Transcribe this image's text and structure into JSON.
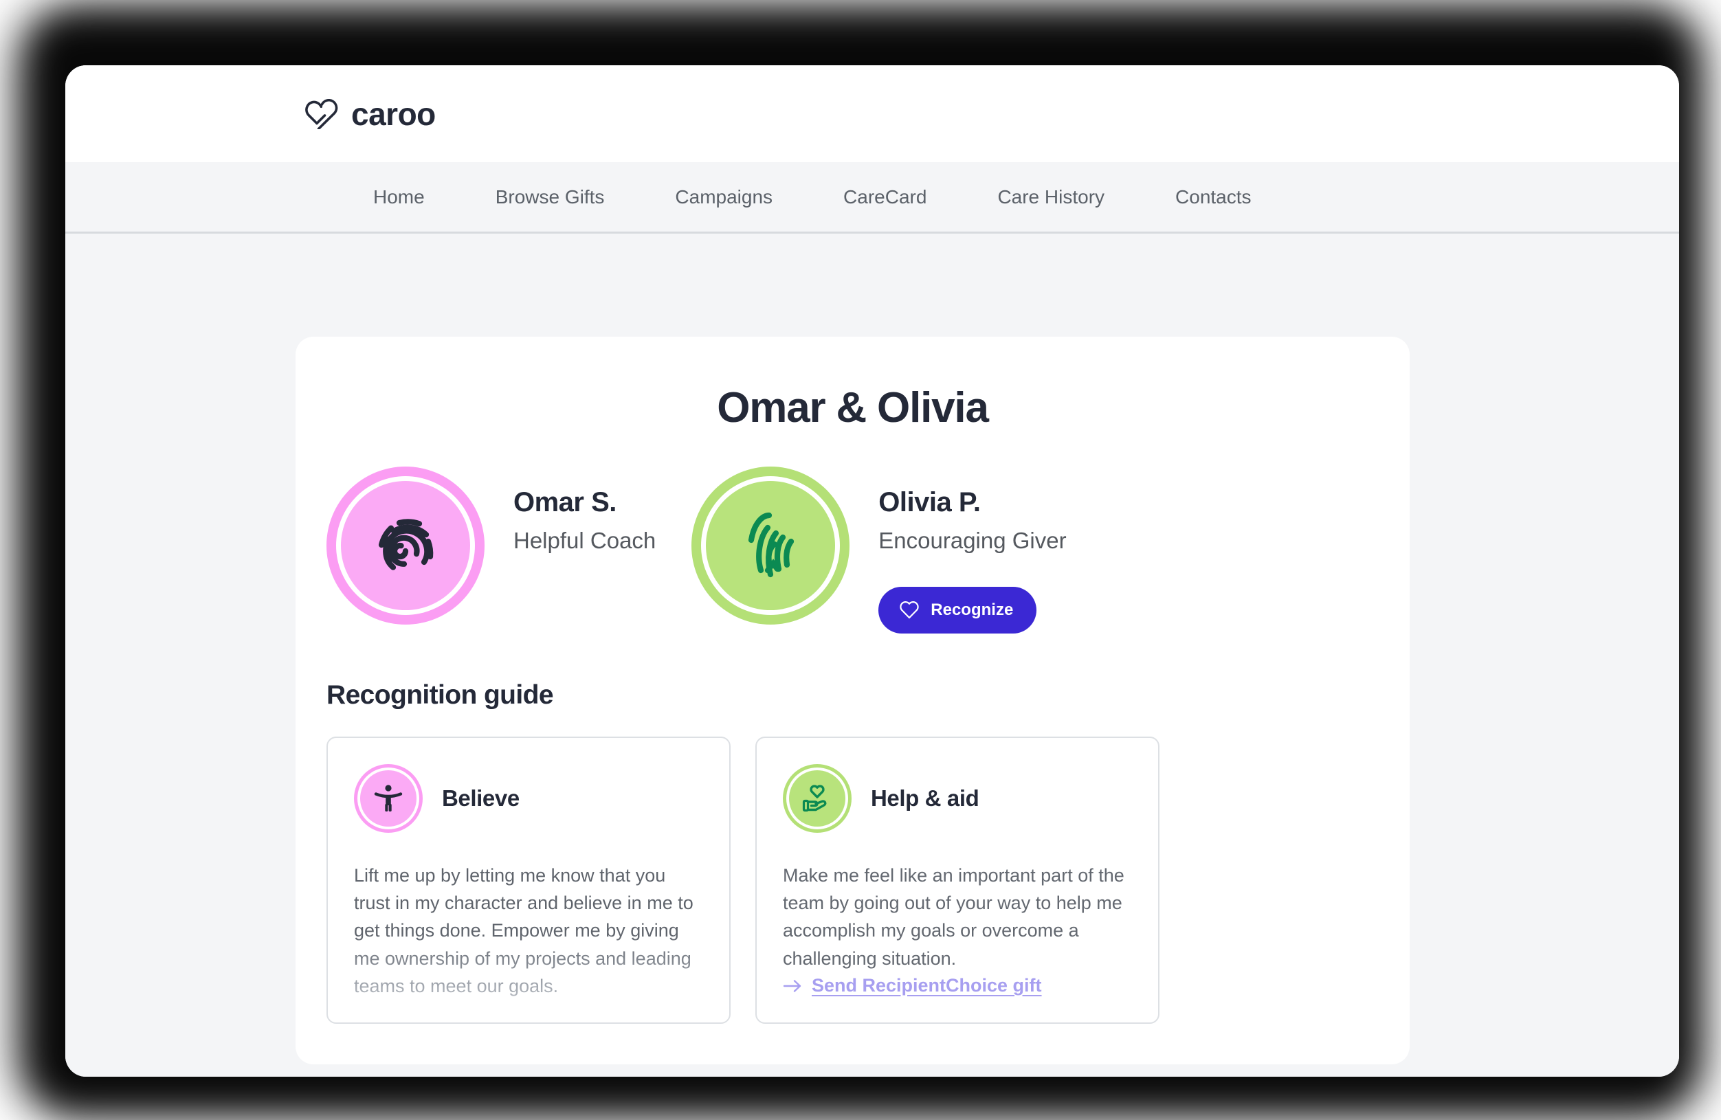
{
  "brand": {
    "name": "caroo",
    "logo_icon": "heart-check-logo-icon"
  },
  "nav": {
    "items": [
      {
        "label": "Home"
      },
      {
        "label": "Browse Gifts"
      },
      {
        "label": "Campaigns"
      },
      {
        "label": "CareCard"
      },
      {
        "label": "Care History"
      },
      {
        "label": "Contacts"
      }
    ]
  },
  "main": {
    "title": "Omar & Olivia",
    "profiles": [
      {
        "name": "Omar S.",
        "role": "Helpful Coach",
        "avatar_icon": "fingerprint-icon",
        "avatar_color": "#fbaaf5",
        "avatar_ring_color": "#fb9df3",
        "glyph_color": "#242938"
      },
      {
        "name": "Olivia P.",
        "role": "Encouraging Giver",
        "avatar_icon": "fingerprint-icon",
        "avatar_color": "#b8e37c",
        "avatar_ring_color": "#b4e076",
        "glyph_color": "#0b8a52",
        "action": {
          "label": "Recognize",
          "icon": "heart-icon",
          "color": "#3b28d4"
        }
      }
    ],
    "guide": {
      "heading": "Recognition guide",
      "cards": [
        {
          "title": "Believe",
          "icon": "person-arms-out-icon",
          "icon_color": "#fbaaf5",
          "icon_ring_color": "#fb9df3",
          "glyph_color": "#242938",
          "body": "Lift me up by letting me know that you trust in my character and believe in me to get things done. Empower me by giving me ownership of my projects and leading teams to meet our goals."
        },
        {
          "title": "Help & aid",
          "icon": "hand-holding-heart-icon",
          "icon_color": "#b8e37c",
          "icon_ring_color": "#b4e076",
          "glyph_color": "#0b8a52",
          "body": "Make me feel like an important part of the team by going out of your way to help me accomplish my goals or overcome a challenging situation.",
          "link": {
            "label": "Send RecipientChoice gift",
            "icon": "arrow-right-icon",
            "color": "#a79ff0"
          }
        }
      ]
    }
  }
}
